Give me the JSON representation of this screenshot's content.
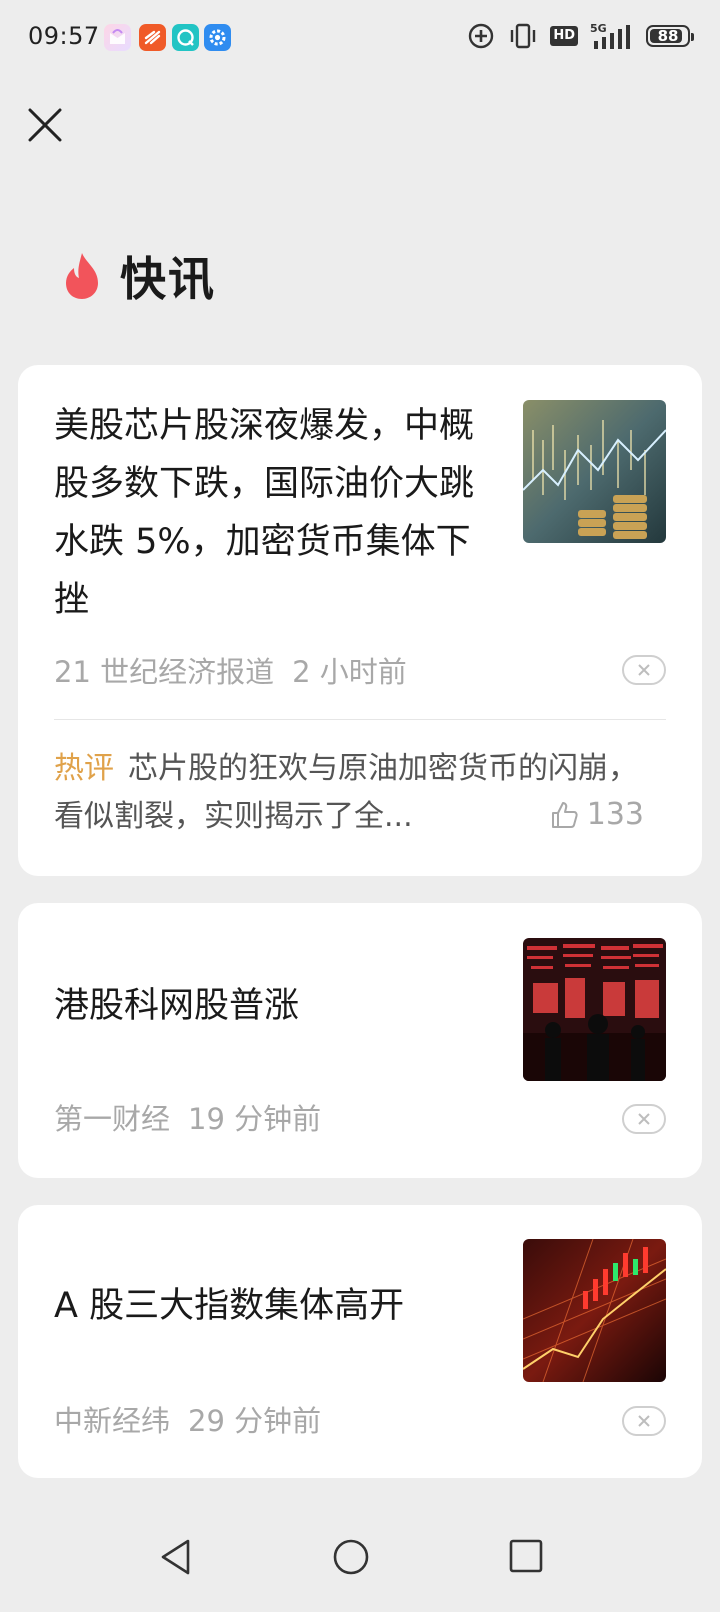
{
  "status_bar": {
    "time": "09:57",
    "network": "5G",
    "hd_label": "HD",
    "battery_level": "88",
    "battery_fraction": 0.88,
    "app_icons": [
      "planner-icon",
      "message-app-icon",
      "browser-app-icon",
      "settings-app-icon"
    ]
  },
  "header": {
    "title": "快讯",
    "icon": "flame-icon",
    "icon_color": "#f2545b"
  },
  "news": [
    {
      "title": "美股芯片股深夜爆发，中概股多数下跌，国际油价大跳水跌 5%，加密货币集体下挫",
      "source": "21 世纪经济报道",
      "time": "2 小时前",
      "comment_label": "热评",
      "comment_text": "芯片股的狂欢与原油加密货币的闪崩，看似割裂，实则揭示了全...",
      "likes": "133"
    },
    {
      "title": "港股科网股普涨",
      "source": "第一财经",
      "time": "19 分钟前"
    },
    {
      "title": "A 股三大指数集体高开",
      "source": "中新经纬",
      "time": "29 分钟前"
    }
  ],
  "colors": {
    "background": "#ededed",
    "card": "#ffffff",
    "hot_label": "#e0a24a",
    "meta_text": "#a8a8a8"
  }
}
